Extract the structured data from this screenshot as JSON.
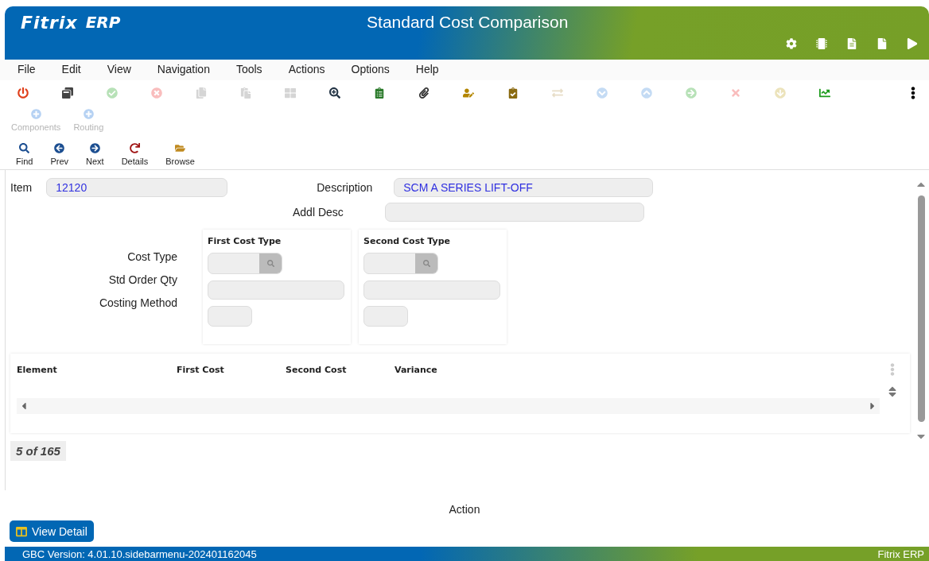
{
  "header": {
    "logo": "Fitrix",
    "logo_suffix": "ERP",
    "title": "Standard Cost Comparison"
  },
  "menu": [
    "File",
    "Edit",
    "View",
    "Navigation",
    "Tools",
    "Actions",
    "Options",
    "Help"
  ],
  "toolbar": [
    {
      "disabled": false
    },
    {
      "disabled": false
    },
    {
      "disabled": true
    },
    {
      "disabled": true
    },
    {
      "disabled": true
    },
    {
      "disabled": true
    },
    {
      "disabled": true
    },
    {
      "disabled": false
    },
    {
      "disabled": false
    },
    {
      "disabled": false
    },
    {
      "disabled": false
    },
    {
      "disabled": false
    },
    {
      "disabled": true
    },
    {
      "disabled": true
    },
    {
      "disabled": true
    },
    {
      "disabled": true
    },
    {
      "disabled": true
    },
    {
      "disabled": true
    },
    {
      "disabled": false
    }
  ],
  "action_buttons": [
    {
      "label": "Components",
      "disabled": true
    },
    {
      "label": "Routing",
      "disabled": true
    }
  ],
  "nav_buttons": [
    {
      "label": "Find",
      "disabled": false
    },
    {
      "label": "Prev",
      "disabled": false
    },
    {
      "label": "Next",
      "disabled": false
    },
    {
      "label": "Details",
      "disabled": false
    },
    {
      "label": "Browse",
      "disabled": false
    }
  ],
  "form": {
    "item_label": "Item",
    "item_value": "12120",
    "description_label": "Description",
    "description_value": "SCM A SERIES LIFT-OFF",
    "addl_desc_label": "Addl Desc",
    "row_labels": [
      "Cost Type",
      "Std Order Qty",
      "Costing Method"
    ],
    "groups": [
      {
        "title": "First Cost Type"
      },
      {
        "title": "Second Cost Type"
      }
    ]
  },
  "table": {
    "columns": [
      "Element",
      "First Cost",
      "Second Cost",
      "Variance"
    ]
  },
  "pager": "5 of 165",
  "action_label": "Action",
  "view_detail": "View Detail",
  "status_bar": {
    "version": "GBC Version: 4.01.10.sidebarmenu-202401162045",
    "product": "Fitrix ERP"
  }
}
